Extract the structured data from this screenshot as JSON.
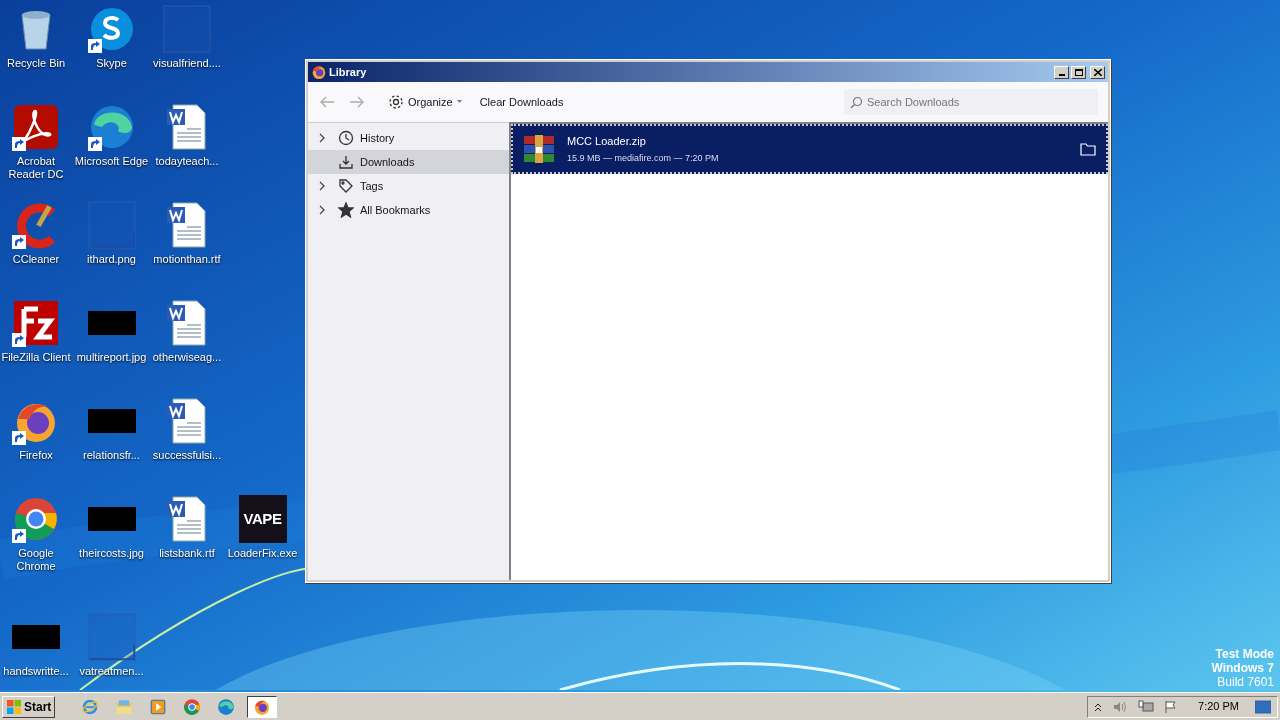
{
  "desktop": {
    "icons": [
      {
        "label": "Recycle Bin",
        "kind": "recycle",
        "shortcut": false
      },
      {
        "label": "Skype",
        "kind": "skype",
        "shortcut": true
      },
      {
        "label": "visualfriend....",
        "kind": "blank",
        "shortcut": false
      },
      {
        "label": "Acrobat Reader DC",
        "kind": "acrobat",
        "shortcut": true
      },
      {
        "label": "Microsoft Edge",
        "kind": "edge",
        "shortcut": true
      },
      {
        "label": "todayteach...",
        "kind": "word",
        "shortcut": false
      },
      {
        "label": "CCleaner",
        "kind": "ccleaner",
        "shortcut": true
      },
      {
        "label": "ithard.png",
        "kind": "blank",
        "shortcut": false
      },
      {
        "label": "motionthan.rtf",
        "kind": "word",
        "shortcut": false
      },
      {
        "label": "FileZilla Client",
        "kind": "filezilla",
        "shortcut": true
      },
      {
        "label": "multireport.jpg",
        "kind": "black",
        "shortcut": false
      },
      {
        "label": "otherwiseag...",
        "kind": "word",
        "shortcut": false
      },
      {
        "label": "Firefox",
        "kind": "firefox",
        "shortcut": true
      },
      {
        "label": "relationsfr...",
        "kind": "black",
        "shortcut": false
      },
      {
        "label": "successfulsi...",
        "kind": "word",
        "shortcut": false
      },
      {
        "label": "Google Chrome",
        "kind": "chrome",
        "shortcut": true
      },
      {
        "label": "theircosts.jpg",
        "kind": "black",
        "shortcut": false
      },
      {
        "label": "listsbank.rtf",
        "kind": "word",
        "shortcut": false
      },
      {
        "label": "LoaderFix.exe",
        "kind": "vape",
        "shortcut": false,
        "logo": "VAPE"
      },
      {
        "label": "handswritte...",
        "kind": "black",
        "shortcut": false
      },
      {
        "label": "vatreatmen...",
        "kind": "blank",
        "shortcut": false
      }
    ],
    "watermark": [
      "Test Mode",
      "Windows 7",
      "Build 7601"
    ]
  },
  "window": {
    "title": "Library",
    "toolbar": {
      "organize": "Organize",
      "clear": "Clear Downloads",
      "search_placeholder": "Search Downloads"
    },
    "sidebar": {
      "items": [
        {
          "label": "History",
          "expandable": true,
          "selected": false
        },
        {
          "label": "Downloads",
          "expandable": false,
          "selected": true
        },
        {
          "label": "Tags",
          "expandable": true,
          "selected": false
        },
        {
          "label": "All Bookmarks",
          "expandable": true,
          "selected": false
        }
      ]
    },
    "downloads": [
      {
        "name": "MCC Loader.zip",
        "details": "15.9 MB — mediafire.com — 7:20 PM",
        "selected": true
      }
    ]
  },
  "taskbar": {
    "start": "Start",
    "apps": [
      {
        "kind": "ie",
        "selected": false
      },
      {
        "kind": "explorer",
        "selected": false
      },
      {
        "kind": "media",
        "selected": false
      },
      {
        "kind": "chrome",
        "selected": false
      },
      {
        "kind": "edge",
        "selected": false
      },
      {
        "kind": "firefox",
        "selected": true
      }
    ],
    "clock": "7:20 PM"
  }
}
